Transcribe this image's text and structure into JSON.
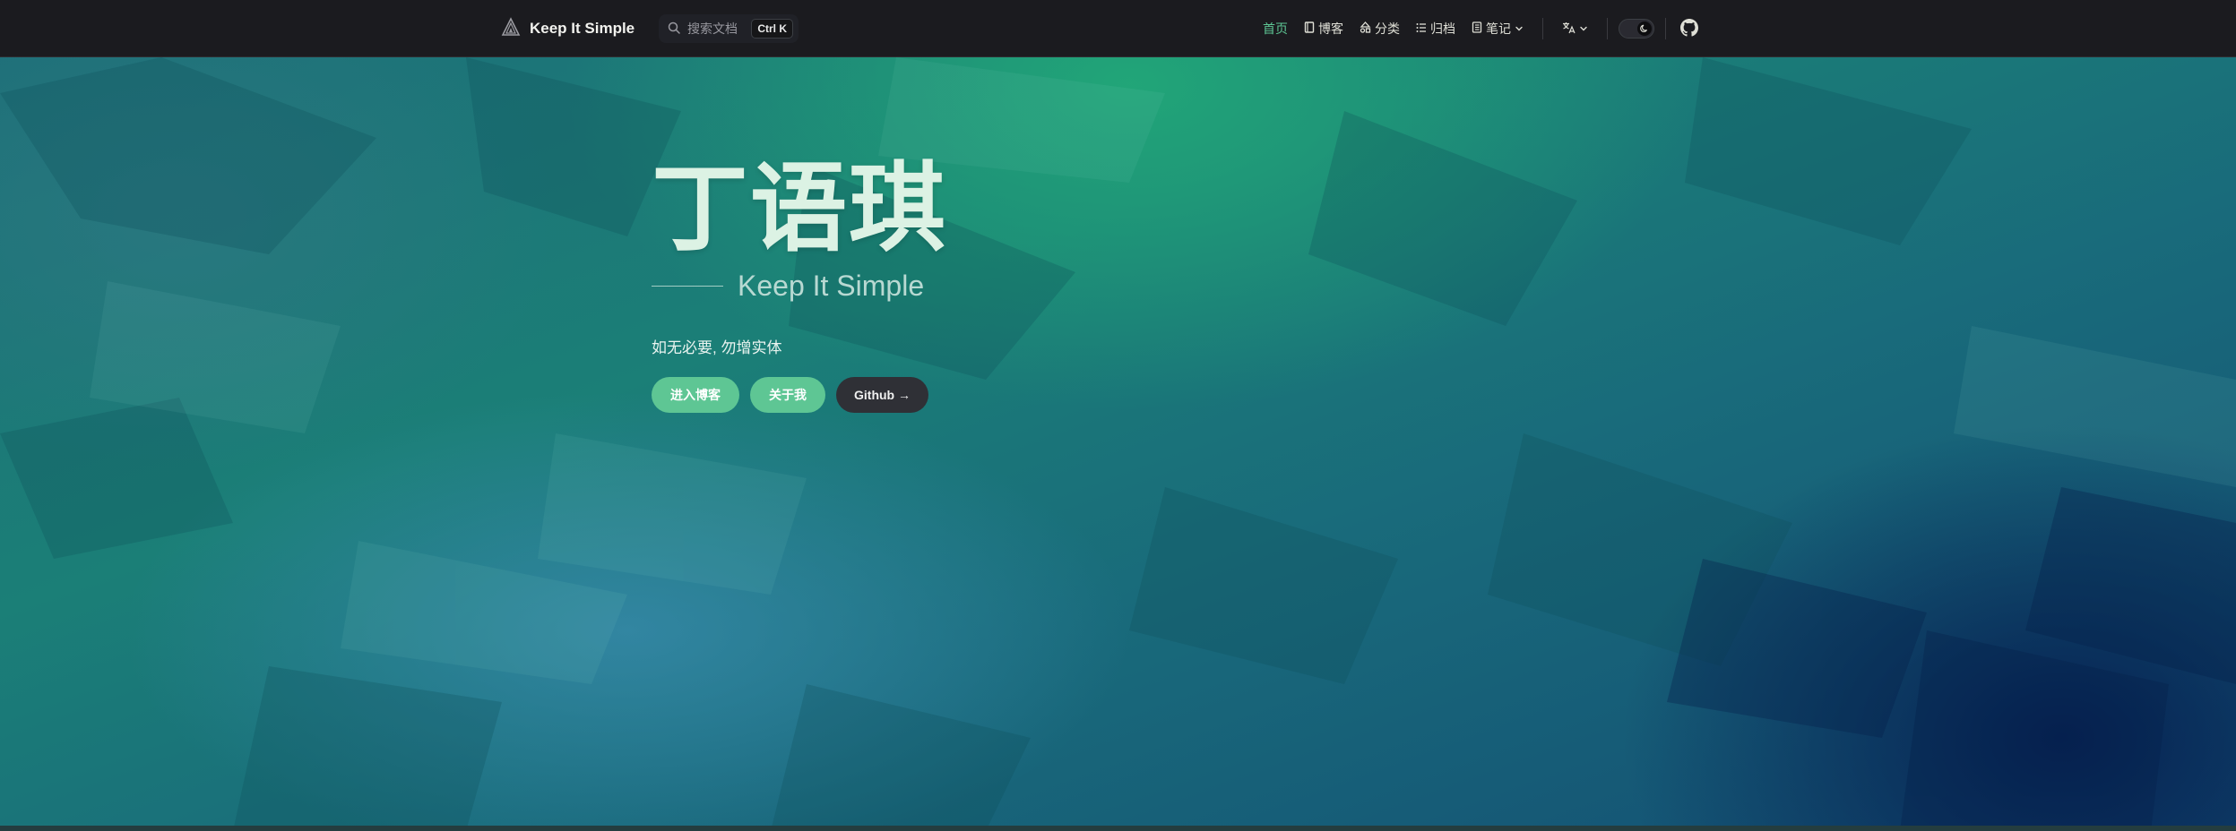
{
  "nav": {
    "brand": "Keep It Simple",
    "search_placeholder": "搜索文档",
    "search_shortcut": "Ctrl K",
    "items": [
      {
        "label": "首页",
        "icon": "none",
        "active": true
      },
      {
        "label": "博客",
        "icon": "book-icon",
        "active": false
      },
      {
        "label": "分类",
        "icon": "shapes-icon",
        "active": false
      },
      {
        "label": "归档",
        "icon": "list-icon",
        "active": false
      },
      {
        "label": "笔记",
        "icon": "notebook-icon",
        "active": false,
        "dropdown": true
      }
    ],
    "language_icon": "translate-icon",
    "theme_toggle": "moon-icon",
    "github_icon": "github-icon"
  },
  "hero": {
    "name": "丁语琪",
    "tagline": "Keep It Simple",
    "motto": "如无必要, 勿增实体",
    "actions": [
      {
        "label": "进入博客",
        "theme": "brand"
      },
      {
        "label": "关于我",
        "theme": "brand"
      },
      {
        "label": "Github →",
        "theme": "alt"
      }
    ]
  },
  "colors": {
    "brand": "#5ec694",
    "nav_bg": "#1b1b1f",
    "hero_teal": "#1b7f77",
    "hero_deep_blue": "#134d73"
  }
}
